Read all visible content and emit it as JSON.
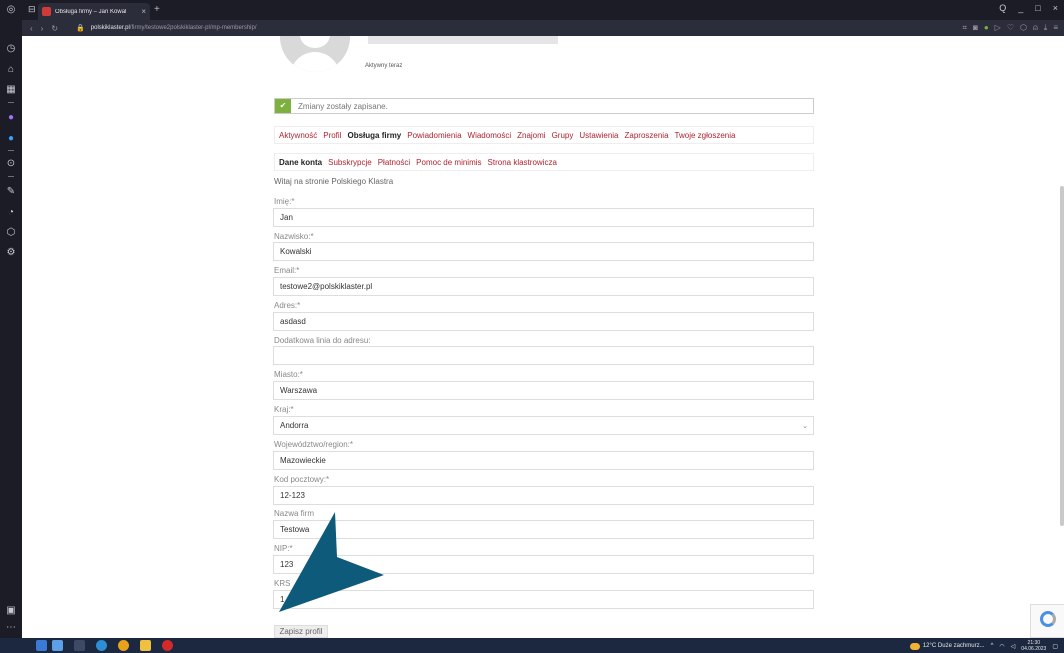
{
  "browser": {
    "tab_title": "Obsługa firmy – Jan Kowal",
    "tab_close": "×",
    "new_tab": "+",
    "url_host": "polskiklaster.pl",
    "url_path": "/firmy/testowe2polskiklaster-pl/mp-membership/",
    "window_controls": [
      "Q",
      "_",
      "□",
      "×"
    ]
  },
  "profile": {
    "status": "Aktywny teraz"
  },
  "notice": {
    "message": "Zmiany zostały zapisane."
  },
  "main_nav": [
    {
      "label": "Aktywność",
      "active": false
    },
    {
      "label": "Profil",
      "active": false
    },
    {
      "label": "Obsługa firmy",
      "active": true
    },
    {
      "label": "Powiadomienia",
      "active": false
    },
    {
      "label": "Wiadomości",
      "active": false
    },
    {
      "label": "Znajomi",
      "active": false
    },
    {
      "label": "Grupy",
      "active": false
    },
    {
      "label": "Ustawienia",
      "active": false
    },
    {
      "label": "Zaproszenia",
      "active": false
    },
    {
      "label": "Twoje zgłoszenia",
      "active": false
    }
  ],
  "sub_nav": [
    {
      "label": "Dane konta",
      "active": true
    },
    {
      "label": "Subskrypcje",
      "active": false
    },
    {
      "label": "Płatności",
      "active": false
    },
    {
      "label": "Pomoc de minimis",
      "active": false
    },
    {
      "label": "Strona klastrowicza",
      "active": false
    }
  ],
  "welcome": "Witaj na stronie Polskiego Klastra",
  "form": {
    "fields": [
      {
        "label": "Imię:*",
        "value": "Jan"
      },
      {
        "label": "Nazwisko:*",
        "value": "Kowalski"
      },
      {
        "label": "Email:*",
        "value": "testowe2@polskiklaster.pl"
      },
      {
        "label": "Adres:*",
        "value": "asdasd"
      },
      {
        "label": "Dodatkowa linia do adresu:",
        "value": ""
      },
      {
        "label": "Miasto:*",
        "value": "Warszawa"
      },
      {
        "label": "Kraj:*",
        "value": "Andorra",
        "type": "select"
      },
      {
        "label": "Województwo/region:*",
        "value": "Mazowieckie"
      },
      {
        "label": "Kod pocztowy:*",
        "value": "12-123"
      },
      {
        "label": "Nazwa firm",
        "value": "Testowa"
      },
      {
        "label": "NIP:*",
        "value": "123"
      },
      {
        "label": "KRS",
        "value": "1"
      }
    ],
    "save_label": "Zapisz profil"
  },
  "taskbar": {
    "weather": "12°C  Duże zachmurz...",
    "time": "21:30",
    "date": "04.06.2023"
  },
  "colors": {
    "accent_link": "#b0242f",
    "success": "#7bb13c",
    "arrow": "#0e5a7a",
    "browser_chrome": "#1b1c26"
  }
}
